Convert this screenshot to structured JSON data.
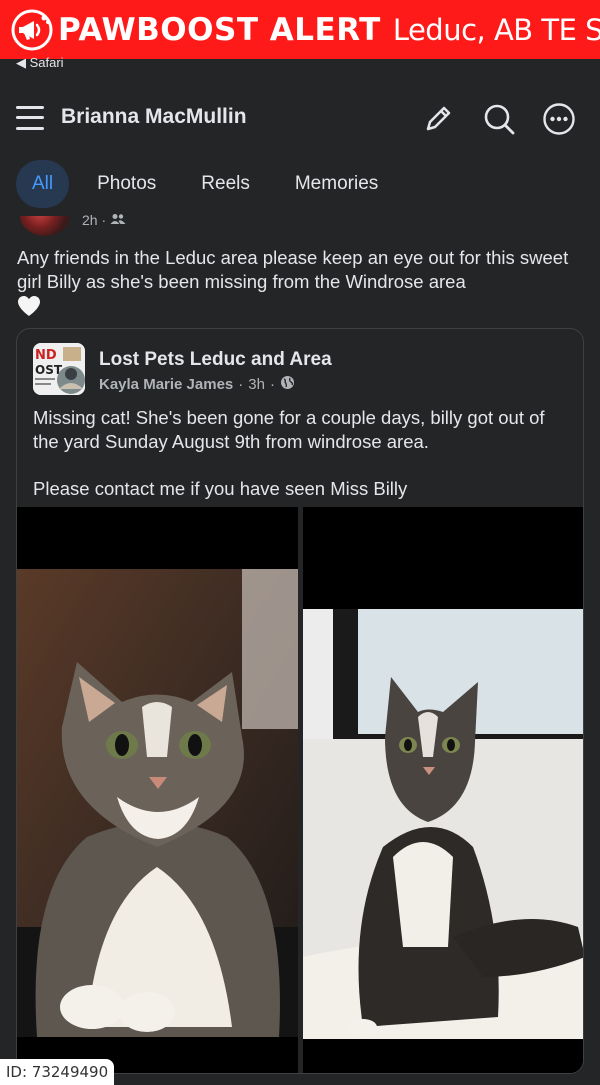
{
  "alert": {
    "brand": "PAWBOOST ALERT",
    "location": "Leduc, AB TE S",
    "color": "#ff1a1a"
  },
  "browser": {
    "back_label": "◀ Safari"
  },
  "header": {
    "profile_name": "Brianna MacMullin",
    "icons": [
      "edit-icon",
      "search-icon",
      "more-icon"
    ]
  },
  "tabs": [
    {
      "label": "All",
      "active": true
    },
    {
      "label": "Photos",
      "active": false
    },
    {
      "label": "Reels",
      "active": false
    },
    {
      "label": "Memories",
      "active": false
    }
  ],
  "post": {
    "time": "2h ·",
    "audience_icon": "friends-icon",
    "text": "Any friends in the Leduc area please keep an eye out for this sweet girl Billy as she's been missing from the Windrose area",
    "emoji": "🤍"
  },
  "shared_post": {
    "group_name": "Lost Pets Leduc and Area",
    "author": "Kayla Marie James",
    "time": "3h",
    "privacy_icon": "globe-icon",
    "line1": "Missing cat! She's been gone for a couple days, billy got out of the yard Sunday August 9th from windrose area.",
    "line2": "Please contact me if you have seen Miss Billy"
  },
  "watermark": {
    "id": "ID: 73249490"
  },
  "colors": {
    "background": "#242526",
    "accent_blue": "#4599ff",
    "tab_active_bg": "#263951",
    "text_primary": "#e4e6eb",
    "text_secondary": "#b0b3b8"
  }
}
